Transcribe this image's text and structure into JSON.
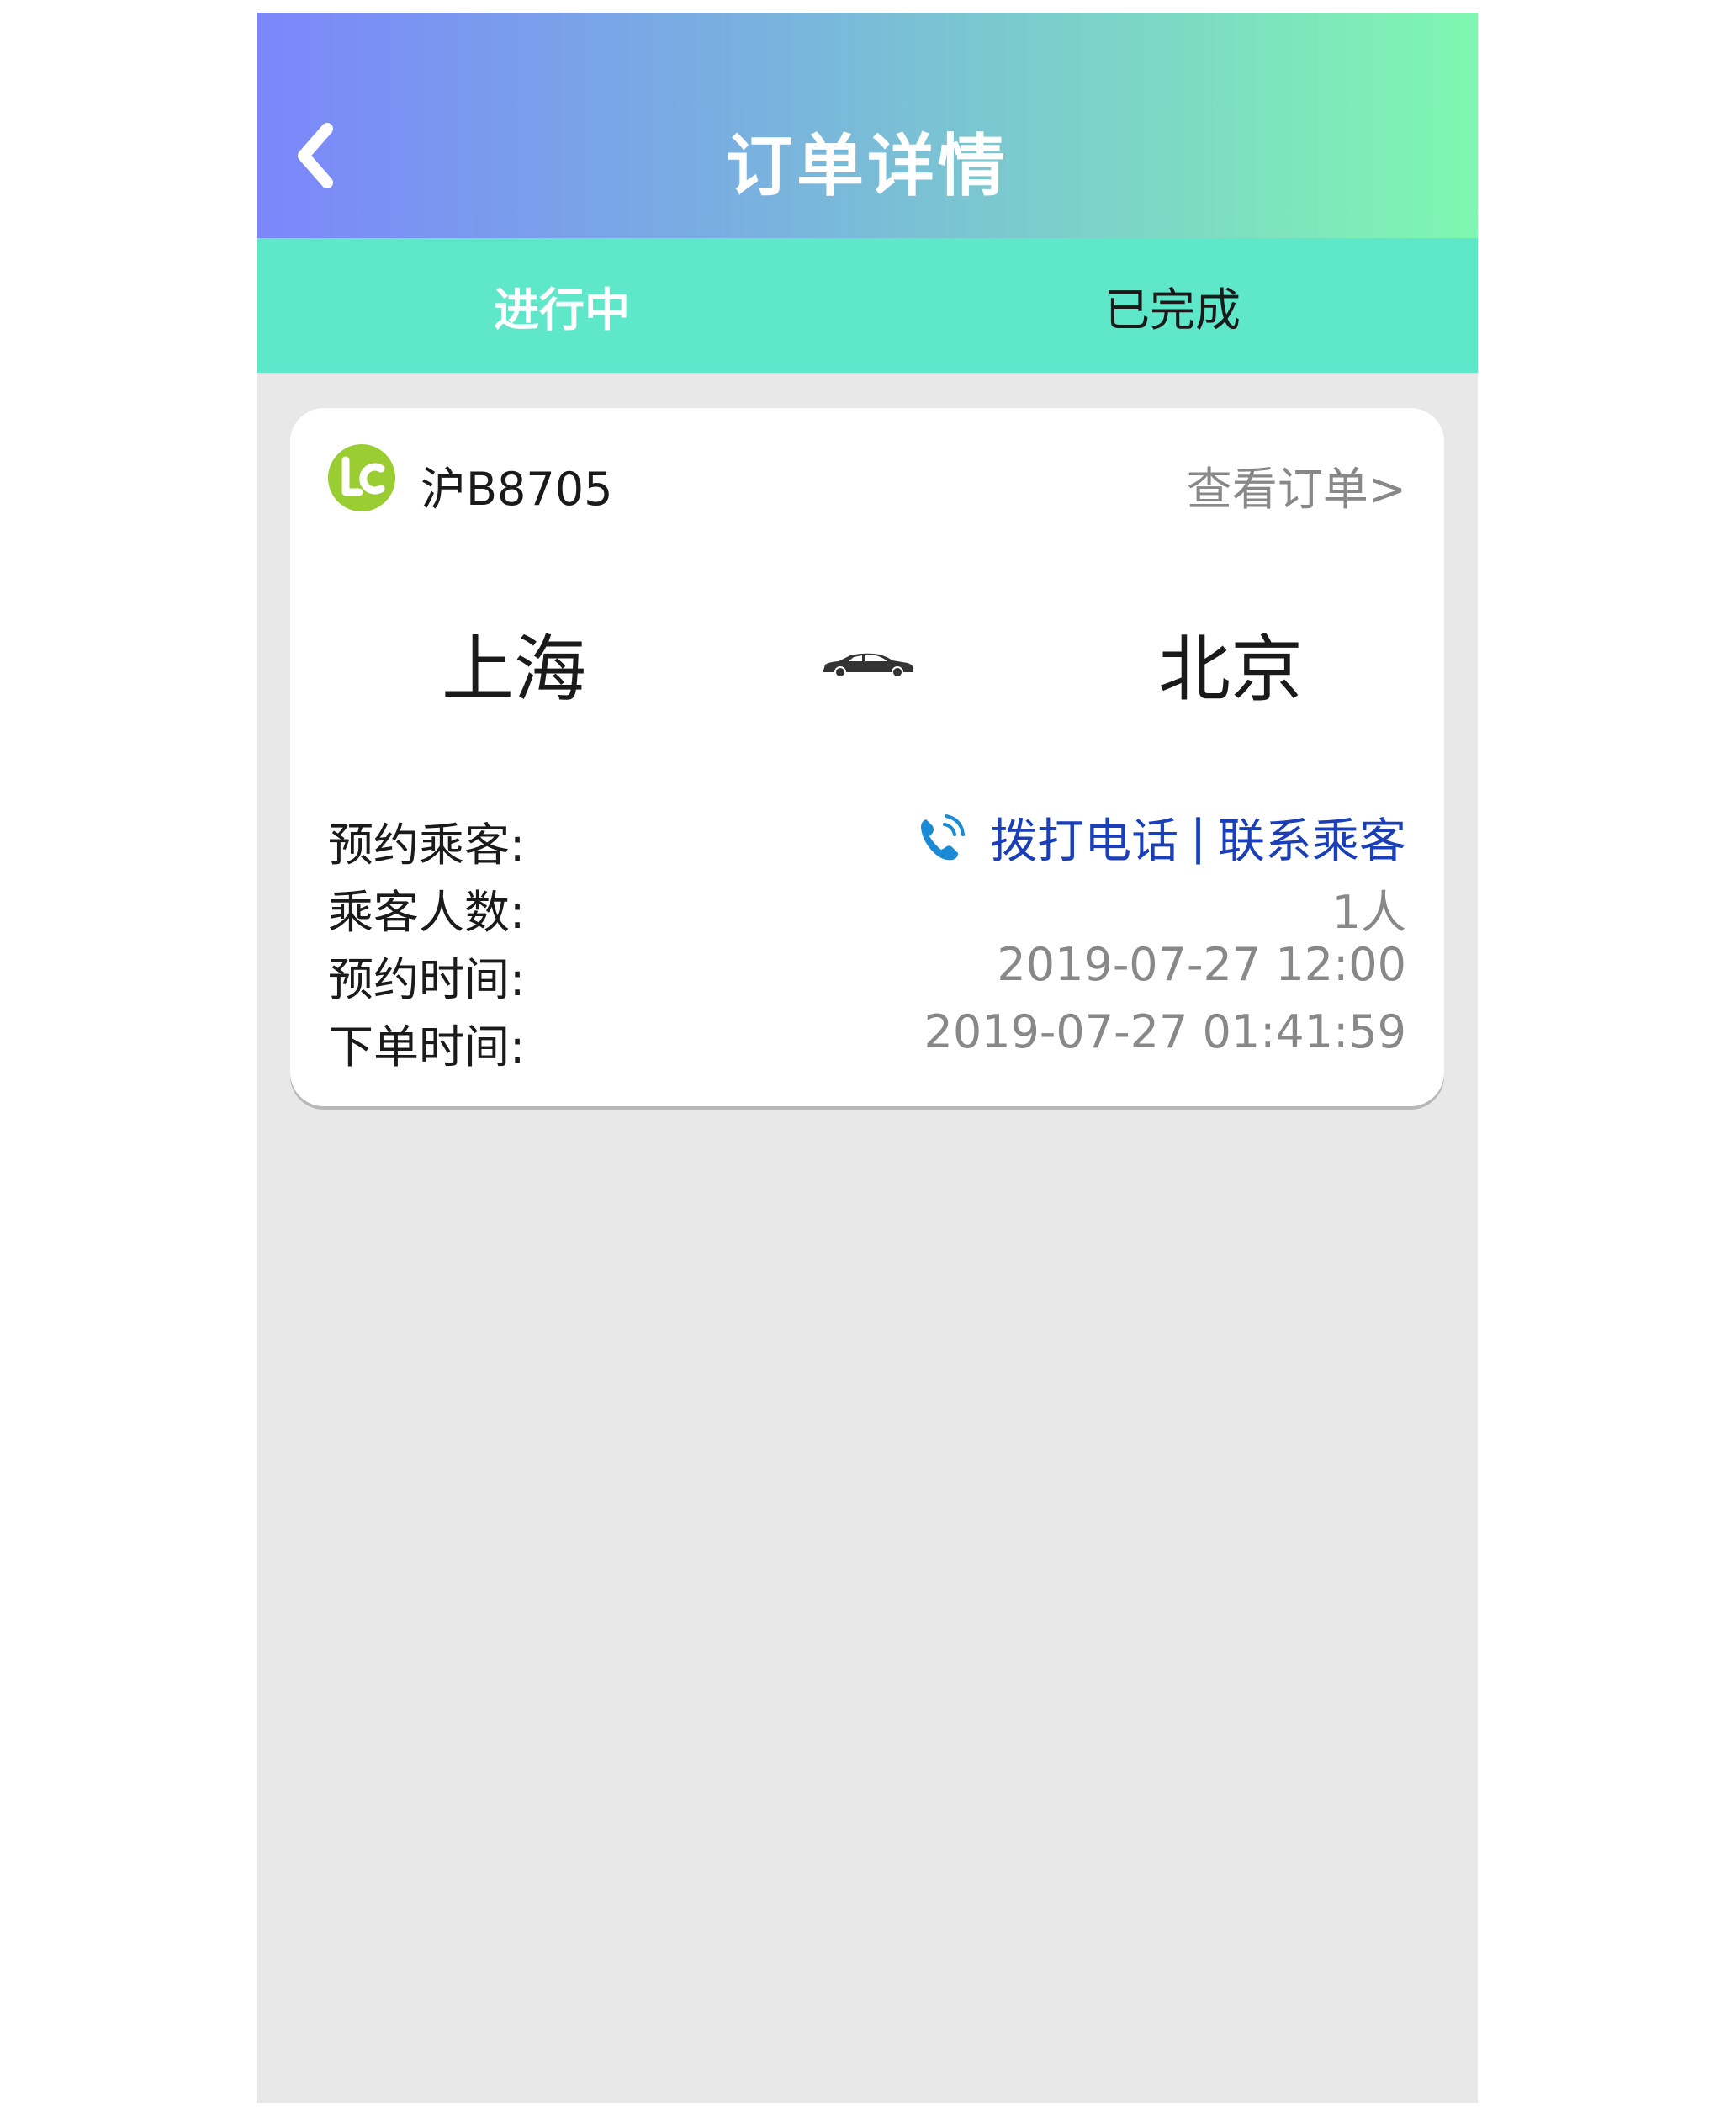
{
  "header": {
    "title": "订单详情"
  },
  "tabs": [
    {
      "label": "进行中",
      "active": true
    },
    {
      "label": "已完成",
      "active": false
    }
  ],
  "order": {
    "plate": "沪B8705",
    "view_order_label": "查看订单>",
    "from_city": "上海",
    "to_city": "北京",
    "fields": {
      "passenger_label": "预约乘客:",
      "count_label": "乘客人数:",
      "count_value": "1人",
      "appointment_label": "预约时间:",
      "appointment_value": "2019-07-27 12:00",
      "order_time_label": "下单时间:",
      "order_time_value": "2019-07-27 01:41:59"
    },
    "contact": {
      "call_label": "拨打电话",
      "separator": "|",
      "contact_label": "联系乘客"
    }
  },
  "colors": {
    "header_gradient_start": "#7b86fb",
    "header_gradient_end": "#7ff7b0",
    "tab_bar": "#5ee8c9",
    "link_blue": "#1a3fb8",
    "logo_green": "#9acd32",
    "background": "#e8e8e8"
  },
  "icons": {
    "back": "chevron-left-icon",
    "logo": "lc-logo-icon",
    "car": "car-icon",
    "phone": "phone-call-icon"
  }
}
